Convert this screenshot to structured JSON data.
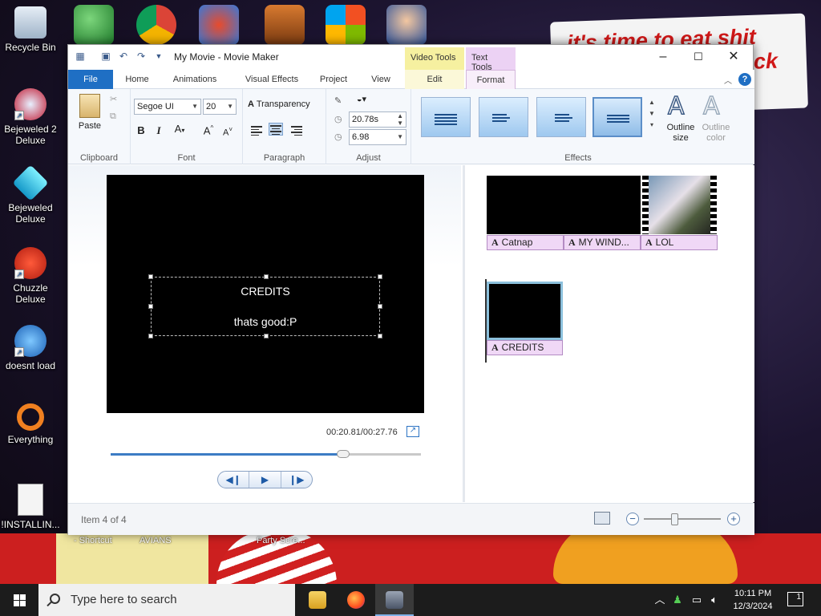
{
  "desktop": {
    "icons": [
      {
        "label": "Recycle Bin"
      },
      {
        "label": "Bejeweled 2 Deluxe"
      },
      {
        "label": "Bejeweled Deluxe"
      },
      {
        "label": "Chuzzle Deluxe"
      },
      {
        "label": "doesnt load"
      },
      {
        "label": "Everything"
      },
      {
        "label": "!INSTALLIN..."
      }
    ],
    "sticker_text": "it's time to eat shit",
    "sticker_text2": "ck",
    "background_labels": [
      "- Shortcut",
      "AVIANS",
      "Party Scre..."
    ]
  },
  "window": {
    "title": "My Movie - Movie Maker",
    "context_tabs": {
      "video": "Video Tools",
      "text": "Text Tools"
    },
    "tabs": [
      "File",
      "Home",
      "Animations",
      "Visual Effects",
      "Project",
      "View",
      "Edit",
      "Format"
    ],
    "ribbon": {
      "clipboard": {
        "paste": "Paste",
        "group": "Clipboard"
      },
      "font": {
        "family": "Segoe UI",
        "size": "20",
        "group": "Font"
      },
      "paragraph": {
        "transparency": "Transparency",
        "group": "Paragraph"
      },
      "adjust": {
        "start_time": "20.78s",
        "duration": "6.98",
        "group": "Adjust"
      },
      "effects": {
        "group": "Effects",
        "outline_size": "Outline size",
        "outline_color": "Outline color"
      }
    },
    "preview": {
      "caption_line1": "CREDITS",
      "caption_line2": "thats good:P",
      "time": "00:20.81/00:27.76",
      "progress": 0.75
    },
    "storyboard": {
      "row1_titles": [
        "Catnap",
        "MY WIND...",
        "LOL"
      ],
      "row2_title": "CREDITS"
    },
    "status": {
      "item": "Item 4 of 4",
      "zoom_level": 0.4
    }
  },
  "taskbar": {
    "search_placeholder": "Type here to search",
    "time": "10:11 PM",
    "date": "12/3/2024",
    "notifications": "1"
  }
}
